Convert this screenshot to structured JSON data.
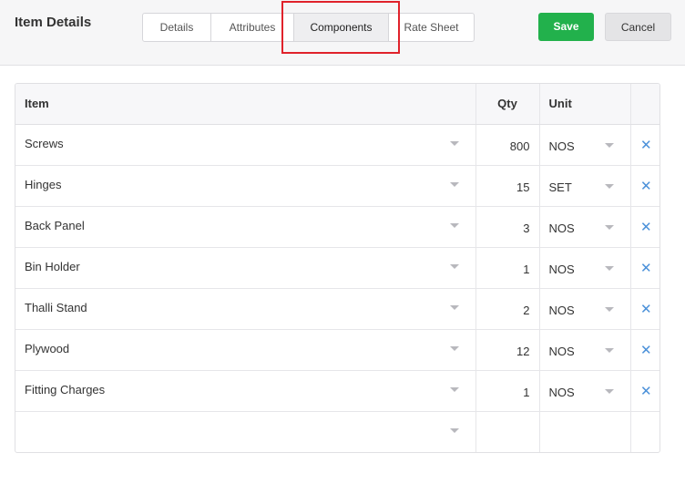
{
  "header": {
    "title": "Item Details",
    "tabs": [
      {
        "label": "Details",
        "active": false
      },
      {
        "label": "Attributes",
        "active": false
      },
      {
        "label": "Components",
        "active": true
      },
      {
        "label": "Rate Sheet",
        "active": false
      }
    ],
    "save_label": "Save",
    "cancel_label": "Cancel"
  },
  "table": {
    "headers": {
      "item": "Item",
      "qty": "Qty",
      "unit": "Unit"
    },
    "rows": [
      {
        "item": "Screws",
        "qty": "800",
        "unit": "NOS"
      },
      {
        "item": "Hinges",
        "qty": "15",
        "unit": "SET"
      },
      {
        "item": "Back Panel",
        "qty": "3",
        "unit": "NOS"
      },
      {
        "item": "Bin Holder",
        "qty": "1",
        "unit": "NOS"
      },
      {
        "item": "Thalli Stand",
        "qty": "2",
        "unit": "NOS"
      },
      {
        "item": "Plywood",
        "qty": "12",
        "unit": "NOS"
      },
      {
        "item": "Fitting Charges",
        "qty": "1",
        "unit": "NOS"
      },
      {
        "item": "",
        "qty": "",
        "unit": ""
      }
    ]
  },
  "colors": {
    "save": "#22b14c",
    "highlight": "#e0222b",
    "delete_icon": "#4a90d9"
  },
  "icons": {
    "dropdown": "caret-down-icon",
    "delete": "close-icon"
  }
}
